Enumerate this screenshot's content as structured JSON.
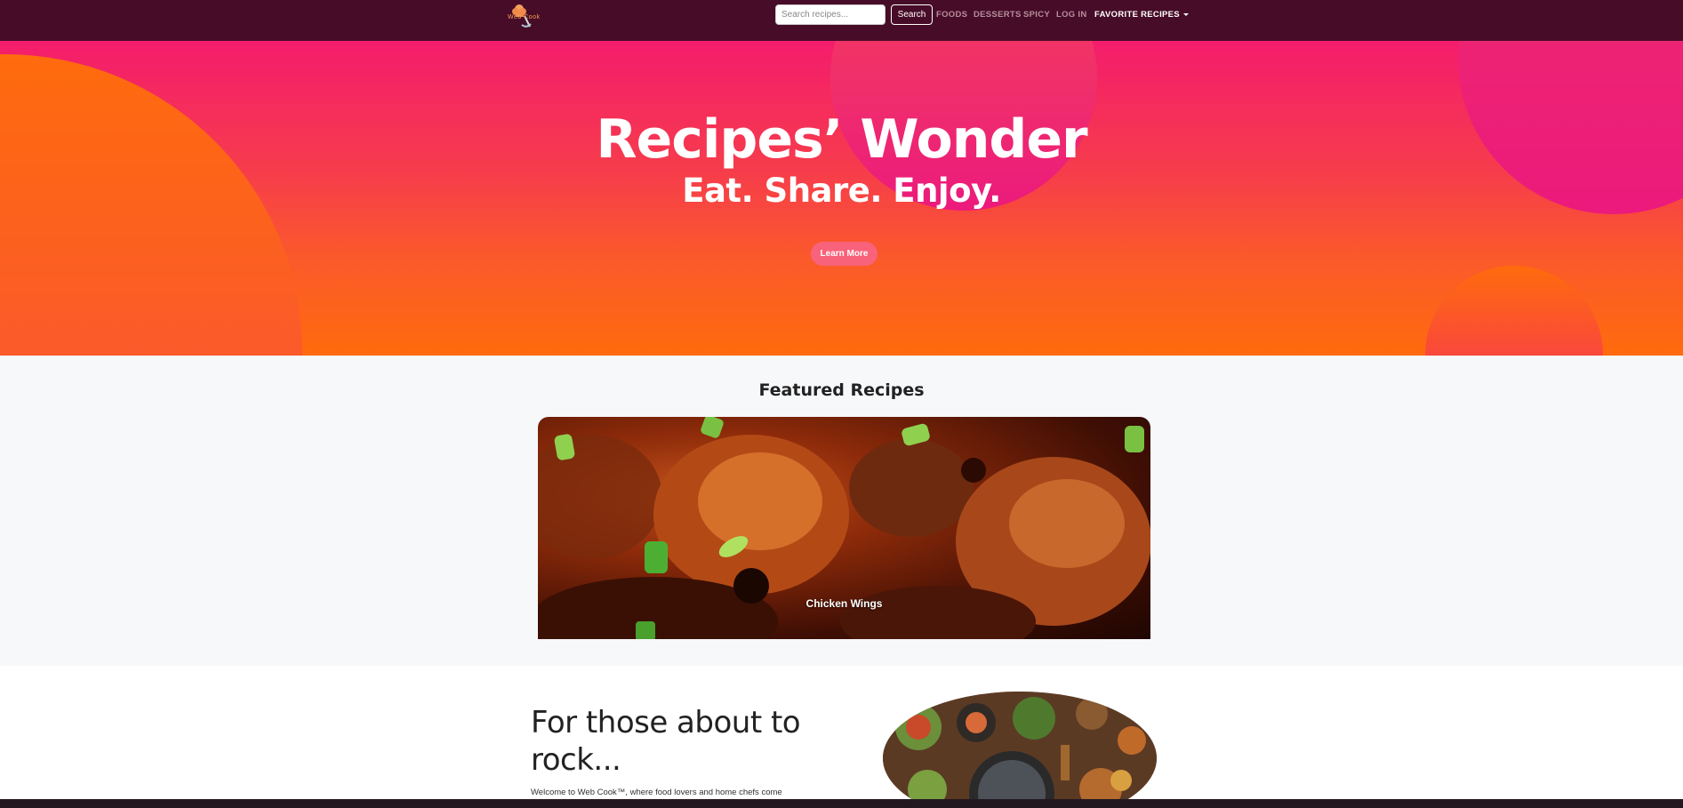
{
  "navbar": {
    "logo_text": "Web Cook",
    "search_placeholder": "Search recipes...",
    "search_button": "Search",
    "links": [
      "FOODS",
      "DESSERTS",
      "SPICY",
      "LOG IN"
    ],
    "dropdown_label": "FAVORITE RECIPES"
  },
  "hero": {
    "title": "Recipes’ Wonder",
    "subtitle": "Eat. Share. Enjoy.",
    "button_label": "Learn More"
  },
  "featured": {
    "heading": "Featured Recipes",
    "caption": "Chicken Wings"
  },
  "about": {
    "heading": "For those about to rock...",
    "text": "Welcome to Web Cook™, where food lovers and home chefs come"
  },
  "colors": {
    "navbar_bg": "#470c27",
    "hero_top": "#f41c6c",
    "hero_bottom": "#ff6b0d",
    "button_pink": "#f8627a"
  }
}
